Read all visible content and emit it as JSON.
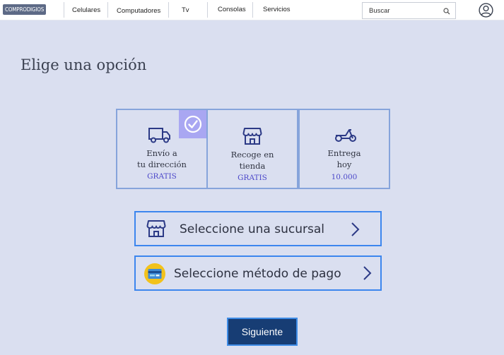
{
  "header": {
    "logo": "COMPRODIGIOS",
    "nav": [
      "Celulares",
      "Computadores",
      "Tv",
      "Consolas",
      "Servicios"
    ],
    "search": {
      "placeholder": "Buscar"
    }
  },
  "main": {
    "title": "Elige una opción",
    "options": [
      {
        "line1": "Envío a",
        "line2": "tu dirección",
        "price": "GRATIS",
        "selected": true
      },
      {
        "line1": "Recoge en",
        "line2": "tienda",
        "price": "GRATIS",
        "selected": false
      },
      {
        "line1": "Entrega",
        "line2": "hoy",
        "price": "10.000",
        "selected": false
      }
    ],
    "actions": {
      "branch": "Seleccione una sucursal",
      "payment": "Seleccione método de pago"
    },
    "next": "Siguiente"
  },
  "colors": {
    "background": "#dadff0",
    "option_border": "#86a4db",
    "selected_badge": "#a9a7f2",
    "action_border": "#3c86ee",
    "primary_button": "#173d74",
    "price_text": "#4b47c9"
  },
  "icons": [
    "search-icon",
    "user-icon",
    "truck-icon",
    "check-icon",
    "store-icon",
    "scooter-icon",
    "card-icon",
    "chevron-right-icon"
  ]
}
